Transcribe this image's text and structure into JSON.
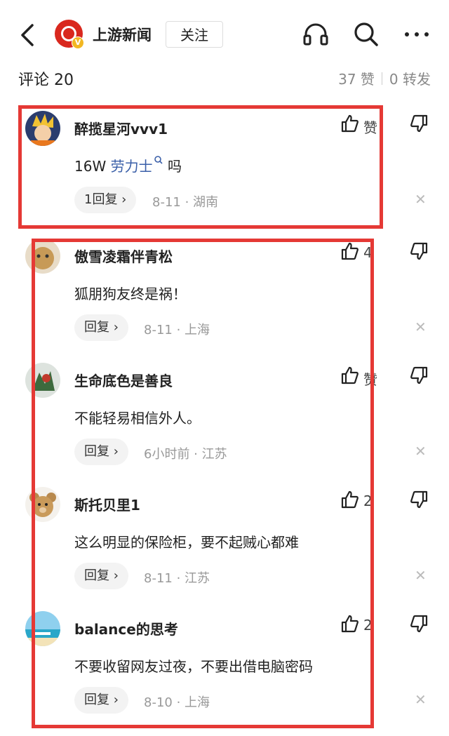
{
  "header": {
    "brand_name": "上游新闻",
    "follow_label": "关注",
    "logo_badge": "V"
  },
  "summary": {
    "comment_count_label": "评论 20",
    "likes_label": "37 赞",
    "shares_label": "0 转发"
  },
  "comments": [
    {
      "user": "醉揽星河vvv1",
      "text_before": "16W ",
      "link_text": "劳力士",
      "text_after": " 吗",
      "reply_label": "1回复 ›",
      "meta": "8-11 · 湖南",
      "like_text": "赞"
    },
    {
      "user": "傲雪凌霜伴青松",
      "text": "狐朋狗友终是祸！",
      "reply_label": "回复 ›",
      "meta": "8-11 · 上海",
      "like_text": "4"
    },
    {
      "user": "生命底色是善良",
      "text": "不能轻易相信外人。",
      "reply_label": "回复 ›",
      "meta": "6小时前 · 江苏",
      "like_text": "赞"
    },
    {
      "user": "斯托贝里1",
      "text": "这么明显的保险柜，要不起贼心都难",
      "reply_label": "回复 ›",
      "meta": "8-11 · 江苏",
      "like_text": "2"
    },
    {
      "user": "balance的思考",
      "text": "不要收留网友过夜，不要出借电脑密码",
      "reply_label": "回复 ›",
      "meta": "8-10 · 上海",
      "like_text": "2"
    }
  ],
  "colors": {
    "accent": "#d9281e",
    "highlight_box": "#e53935",
    "link": "#3a5fa8"
  }
}
